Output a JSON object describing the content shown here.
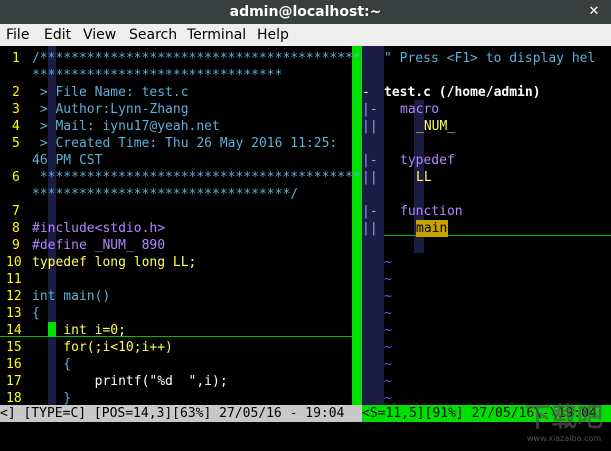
{
  "window": {
    "title": "admin@localhost:~",
    "close_glyph": "✕"
  },
  "menu": {
    "items": [
      "File",
      "Edit",
      "View",
      "Search",
      "Terminal",
      "Help"
    ]
  },
  "left_code": [
    {
      "num": "1",
      "text": "/*****************************************"
    },
    {
      "num": "",
      "text": "********************************"
    },
    {
      "num": "2",
      "text": " > File Name: test.c"
    },
    {
      "num": "3",
      "text": " > Author:Lynn-Zhang"
    },
    {
      "num": "4",
      "text": " > Mail: iynu17@yeah.net"
    },
    {
      "num": "5",
      "text": " > Created Time: Thu 26 May 2016 11:25:"
    },
    {
      "num": "",
      "text": "46 PM CST"
    },
    {
      "num": "6",
      "text": " *****************************************"
    },
    {
      "num": "",
      "text": "*********************************/"
    },
    {
      "num": "7",
      "text": ""
    },
    {
      "num": "8",
      "text": "#include<stdio.h>"
    },
    {
      "num": "9",
      "text": "#define _NUM_ 890"
    },
    {
      "num": "10",
      "text": "typedef long long LL;"
    },
    {
      "num": "11",
      "text": ""
    },
    {
      "num": "12",
      "text": "int main()"
    },
    {
      "num": "13",
      "text": "{"
    },
    {
      "num": "14",
      "text": "    int i=0;"
    },
    {
      "num": "15",
      "text": "    for(;i<10;i++)"
    },
    {
      "num": "16",
      "text": "    {"
    },
    {
      "num": "17",
      "text": "        printf(\"%d  \",i);"
    },
    {
      "num": "18",
      "text": "    }"
    }
  ],
  "right_panel": {
    "help_line": "\" Press <F1> to display hel",
    "file_line": "test.c (/home/admin)",
    "tree": [
      {
        "fold": "|-",
        "text": "macro"
      },
      {
        "fold": "||",
        "text": "_NUM_"
      },
      {
        "fold": "",
        "text": ""
      },
      {
        "fold": "|-",
        "text": "typedef"
      },
      {
        "fold": "||",
        "text": "LL"
      },
      {
        "fold": "",
        "text": ""
      },
      {
        "fold": "|-",
        "text": "function"
      },
      {
        "fold": "||",
        "text": "main"
      }
    ],
    "tilde": "~",
    "tilde_count": 9
  },
  "status": {
    "left": "<] [TYPE=C] [POS=14,3][63%] 27/05/16 - 19:04",
    "right": "<S=11,5][91%] 27/05/16\\-\\19:04"
  },
  "watermark": {
    "text": "下载吧",
    "sub": "www.xiazaiba.com"
  },
  "colors": {
    "bg": "#000000",
    "linenum": "#ffff00",
    "comment": "#5fafd7",
    "keyword": "#ffff55",
    "preproc": "#af87ff",
    "string": "#ff5f5f",
    "statement": "#ffff55",
    "green": "#00e000",
    "sidebar": "#1c1c44",
    "statusbar": "#c8c8c8"
  }
}
